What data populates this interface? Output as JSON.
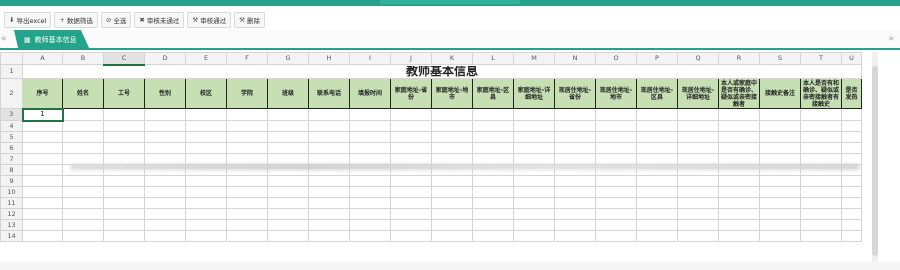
{
  "header": {
    "title": ""
  },
  "toolbar": {
    "buttons": [
      {
        "icon": "download-icon",
        "glyph": "⬇",
        "label": "导出excel"
      },
      {
        "icon": "plus-icon",
        "glyph": "+",
        "label": "数据筛选"
      },
      {
        "icon": "select-all-icon",
        "glyph": "⊘",
        "label": "全选"
      },
      {
        "icon": "close-icon",
        "glyph": "✖",
        "label": "审核未通过"
      },
      {
        "icon": "hammer-icon",
        "glyph": "⚒",
        "label": "审核通过"
      },
      {
        "icon": "hammer-icon",
        "glyph": "⚒",
        "label": "删除"
      }
    ]
  },
  "tabs": [
    {
      "label": "教师基本信息",
      "icon": "grid-icon",
      "glyph": "▦"
    }
  ],
  "nav": {
    "left": "«",
    "right": "»"
  },
  "sheet": {
    "columns": [
      "A",
      "B",
      "C",
      "D",
      "E",
      "F",
      "G",
      "H",
      "I",
      "J",
      "K",
      "L",
      "M",
      "N",
      "O",
      "P",
      "Q",
      "R",
      "S",
      "T",
      "U"
    ],
    "selected_column": "C",
    "title": "教师基本信息",
    "headers": [
      "序号",
      "姓名",
      "工号",
      "性别",
      "校区",
      "学院",
      "班级",
      "联系电话",
      "填报时间",
      "家庭地址-省份",
      "家庭地址-地市",
      "家庭地址-区县",
      "家庭地址-详细地址",
      "现居住地址-省份",
      "现居住地址-地市",
      "现居住地址-区县",
      "现居住地址-详细地址",
      "本人或家庭中是否有确诊、疑似或亲密接触者",
      "接触史备注",
      "本人是否有和确诊、疑似或亲密接触者有接触史",
      "是否发热"
    ],
    "row_numbers": [
      "1",
      "2",
      "3",
      "4",
      "5",
      "6",
      "7",
      "8",
      "9",
      "10",
      "11",
      "12",
      "13",
      "14"
    ],
    "first_index": "1"
  }
}
